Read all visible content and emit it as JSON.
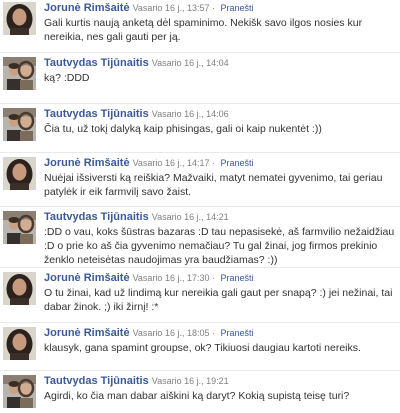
{
  "posts": [
    {
      "author": "Jorunė Rimšaitė",
      "date": "Vasario 16 j., 13:57",
      "report": "Pranešti",
      "text": "Gali kurtis naują anketą dėl spaminimo. Nekišk savo ilgos nosies kur nereikia, nes gali gauti per ją."
    },
    {
      "author": "Tautvydas Tijūnaitis",
      "date": "Vasario 16 j., 14:04",
      "report": "",
      "text": "ką? :DDD"
    },
    {
      "author": "Tautvydas Tijūnaitis",
      "date": "Vasario 16 j., 14:06",
      "report": "",
      "text": "Čia tu, už tokį dalyką kaip phisingas, gali oi kaip nukentėt :))"
    },
    {
      "author": "Jorunė Rimšaitė",
      "date": "Vasario 16 j., 14:17",
      "report": "Pranešti",
      "text": "Nuėjai išsiversti ką reiškia? Mažvaiki, matyt nematei gyvenimo, tai geriau patylėk ir eik farmvilį savo žaist."
    },
    {
      "author": "Tautvydas Tijūnaitis",
      "date": "Vasario 16 j., 14:21",
      "report": "",
      "text": ":DD o vau, koks šūstras bazaras :D tau nepasisekė, aš farmvilio nežaidžiau :D o prie ko aš čia gyvenimo nemačiau? Tu gal žinai, jog firmos prekinio ženklo neteisėtas naudojimas yra baudžiamas? :))"
    },
    {
      "author": "Jorunė Rimšaitė",
      "date": "Vasario 16 j., 17:30",
      "report": "Pranešti",
      "text": "O tu žinai, kad už lindimą kur nereikia gali gaut per snapą? :) jei nežinai, tai dabar žinok. ;) iki žirnį! :*"
    },
    {
      "author": "Jorunė Rimšaitė",
      "date": "Vasario 16 j., 18:05",
      "report": "Pranešti",
      "text": "klausyk, gana spamint groupse, ok? Tikiuosi daugiau kartoti nereiks."
    },
    {
      "author": "Tautvydas Tijūnaitis",
      "date": "Vasario 16 j., 19:21",
      "report": "",
      "text": "Agirdi, ko čia man dabar aiškini ką daryt? Kokią supistą teisę turi?"
    }
  ]
}
